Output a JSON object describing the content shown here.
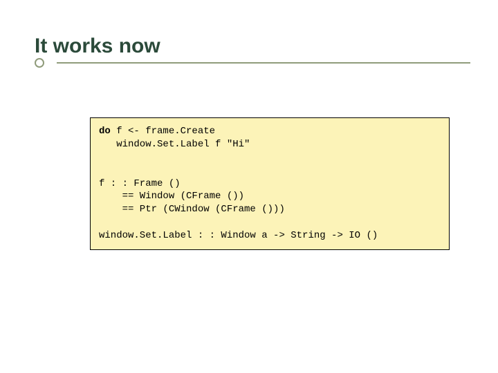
{
  "title": "It works now",
  "code": {
    "l1_kw": "do",
    "l1_rest": " f <- frame.Create",
    "l2": "   window.Set.Label f \"Hi\"",
    "blank1": "",
    "blank2": "",
    "l3": "f : : Frame ()",
    "l4": "    == Window (CFrame ())",
    "l5": "    == Ptr (CWindow (CFrame ()))",
    "blank3": "",
    "l6": "window.Set.Label : : Window a -> String -> IO ()"
  }
}
